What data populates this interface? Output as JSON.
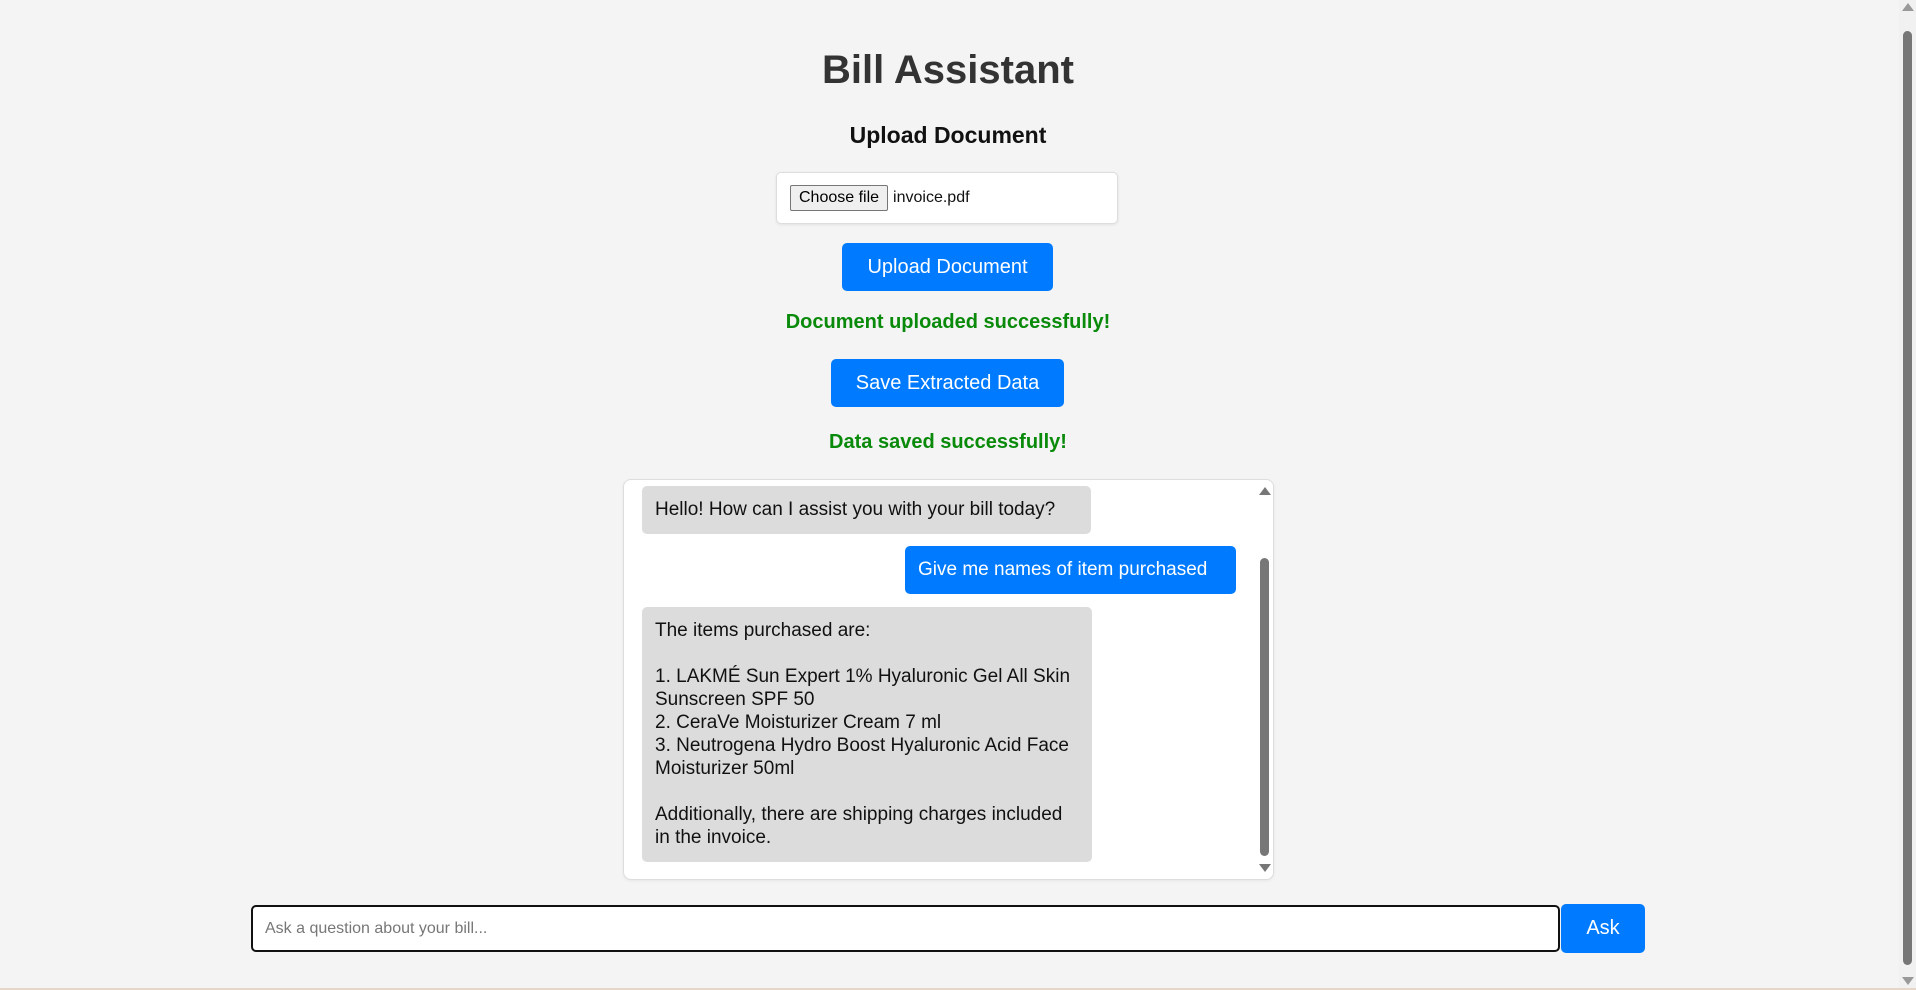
{
  "app": {
    "title": "Bill Assistant"
  },
  "upload": {
    "section_title": "Upload Document",
    "choose_file_label": "Choose file",
    "file_name": "invoice.pdf",
    "upload_button": "Upload Document",
    "success_message": "Document uploaded successfully!"
  },
  "save": {
    "button": "Save Extracted Data",
    "success_message": "Data saved successfully!"
  },
  "chat": {
    "messages": [
      {
        "role": "assistant",
        "text": "Hello! How can I assist you with your bill today?"
      },
      {
        "role": "user",
        "text": "Give me names of item purchased"
      },
      {
        "role": "assistant",
        "intro": "The items purchased are:",
        "items": [
          "1. LAKMÉ Sun Expert 1% Hyaluronic Gel All Skin Sunscreen SPF 50",
          "2. CeraVe Moisturizer Cream 7 ml",
          "3. Neutrogena Hydro Boost Hyaluronic Acid Face Moisturizer 50ml"
        ],
        "outro": "Additionally, there are shipping charges included in the invoice."
      }
    ]
  },
  "ask": {
    "placeholder": "Ask a question about your bill...",
    "value": "",
    "button": "Ask"
  },
  "colors": {
    "accent": "#007bff",
    "success": "#0a8a0a",
    "background": "#f4f4f4",
    "bot_bubble": "#dcdcdc"
  }
}
